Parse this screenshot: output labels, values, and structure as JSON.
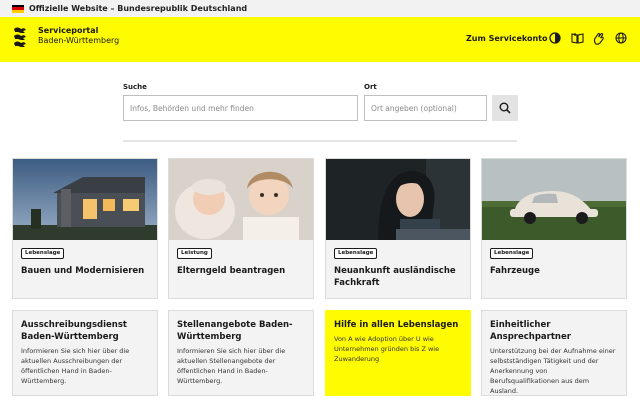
{
  "topbar": {
    "text": "Offizielle Website – Bundesrepublik Deutschland",
    "flag_colors": [
      "#000000",
      "#dd0000",
      "#ffce00"
    ]
  },
  "header": {
    "title": "Serviceportal",
    "subtitle": "Baden-Württemberg",
    "servicekonto_label": "Zum Servicekonto",
    "icons": [
      "contrast-icon",
      "book-icon",
      "sign-language-icon",
      "globe-icon"
    ],
    "background": "#fffb00"
  },
  "search": {
    "label": "Suche",
    "placeholder": "Infos, Behörden und mehr finden",
    "location_label": "Ort",
    "location_placeholder": "Ort angeben (optional)",
    "button_icon": "search-icon"
  },
  "cards": [
    {
      "badge": "Lebenslage",
      "title": "Bauen und Modernisieren"
    },
    {
      "badge": "Leistung",
      "title": "Elterngeld beantragen"
    },
    {
      "badge": "Lebenslage",
      "title": "Neuankunft ausländische Fachkraft"
    },
    {
      "badge": "Lebenslage",
      "title": "Fahrzeuge"
    }
  ],
  "text_cards": [
    {
      "title": "Ausschreibungsdienst Baden-Württemberg",
      "description": "Informieren Sie sich hier über die aktuellen Ausschreibungen der öffentlichen Hand in Baden-Württemberg."
    },
    {
      "title": "Stellenangebote Baden-Württemberg",
      "description": "Informieren Sie sich hier über die aktuellen Stellenangebote der öffentlichen Hand in Baden-Württemberg."
    },
    {
      "title": "Hilfe in allen Lebenslagen",
      "description": "Von A wie Adoption über U wie Unternehmen gründen bis Z wie Zuwanderung"
    },
    {
      "title": "Einheitlicher Ansprechpartner",
      "description": "Unterstützung bei der Aufnahme einer selbstständigen Tätigkeit und der Anerkennung von Berufsqualifikationen aus dem Ausland."
    }
  ]
}
